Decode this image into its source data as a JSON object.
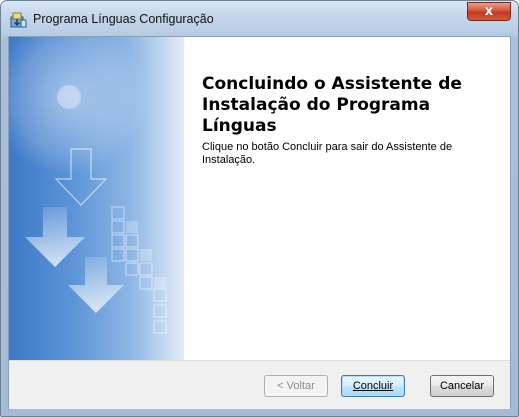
{
  "window": {
    "title": "Programa Línguas Configuração",
    "close_label": "x",
    "app_icon": "setup-package-icon",
    "close_icon": "close-icon"
  },
  "main": {
    "heading": "Concluindo o Assistente de Instalação do Programa Línguas",
    "description": "Clique no botão Concluir para sair do Assistente de Instalação."
  },
  "side_panel": {
    "graphic": "installer-arrows-graphic"
  },
  "footer": {
    "back_label": "< Voltar",
    "finish_label": "Concluir",
    "cancel_label": "Cancelar"
  },
  "colors": {
    "panel_blue": "#3e79c7",
    "titlebar": "#c4d6eb",
    "close_red": "#c23b21",
    "default_button_border": "#3c7fb1"
  }
}
